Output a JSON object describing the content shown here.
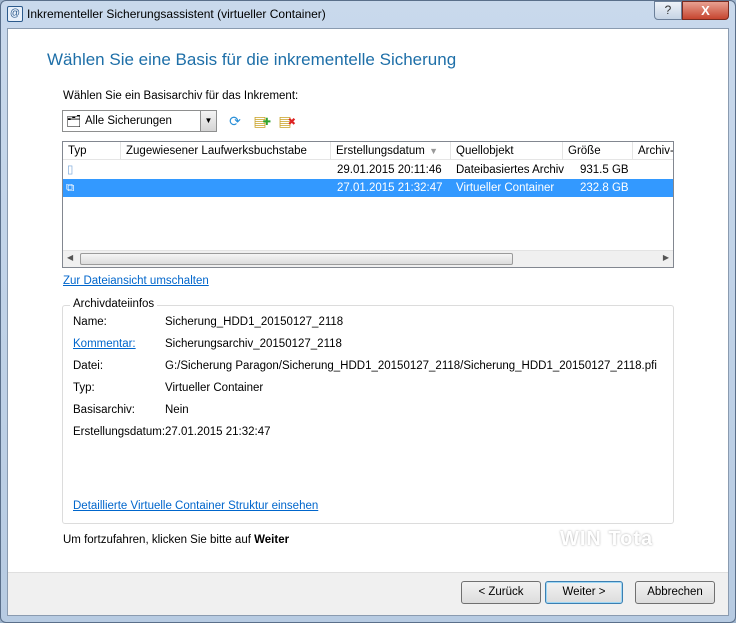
{
  "window": {
    "title": "Inkrementeller Sicherungsassistent (virtueller Container)",
    "help": "?",
    "close": "X"
  },
  "heading": "Wählen Sie eine Basis für die inkrementelle Sicherung",
  "select_label": "Wählen Sie ein Basisarchiv für das Inkrement:",
  "filter": {
    "value": "Alle Sicherungen"
  },
  "table": {
    "columns": [
      "Typ",
      "Zugewiesener Laufwerksbuchstabe",
      "Erstellungsdatum",
      "Quellobjekt",
      "Größe",
      "Archiv-C"
    ],
    "rows": [
      {
        "drive": "",
        "date": "29.01.2015 20:11:46",
        "source": "Dateibasiertes Archiv",
        "size": "931.5 GB"
      },
      {
        "drive": "",
        "date": "27.01.2015 21:32:47",
        "source": "Virtueller Container",
        "size": "232.8 GB"
      }
    ]
  },
  "switch_view_link": "Zur Dateiansicht umschalten",
  "info": {
    "legend": "Archivdateiinfos",
    "fields": [
      {
        "label": "Name:",
        "value": "Sicherung_HDD1_20150127_2118"
      },
      {
        "label": "Kommentar:",
        "value": "Sicherungsarchiv_20150127_2118"
      },
      {
        "label": "Datei:",
        "value": "G:/Sicherung Paragon/Sicherung_HDD1_20150127_2118/Sicherung_HDD1_20150127_2118.pfi"
      },
      {
        "label": "Typ:",
        "value": "Virtueller Container"
      },
      {
        "label": "Basisarchiv:",
        "value": "Nein"
      },
      {
        "label": "Erstellungsdatum:",
        "value": "27.01.2015 21:32:47"
      }
    ],
    "detail_link": "Detaillierte Virtuelle Container Struktur einsehen"
  },
  "hint": {
    "text": "Um fortzufahren, klicken Sie bitte auf ",
    "bold": "Weiter"
  },
  "watermark": "WIN Tota",
  "buttons": {
    "back": "< Zurück",
    "next": "Weiter >",
    "cancel": "Abbrechen"
  }
}
